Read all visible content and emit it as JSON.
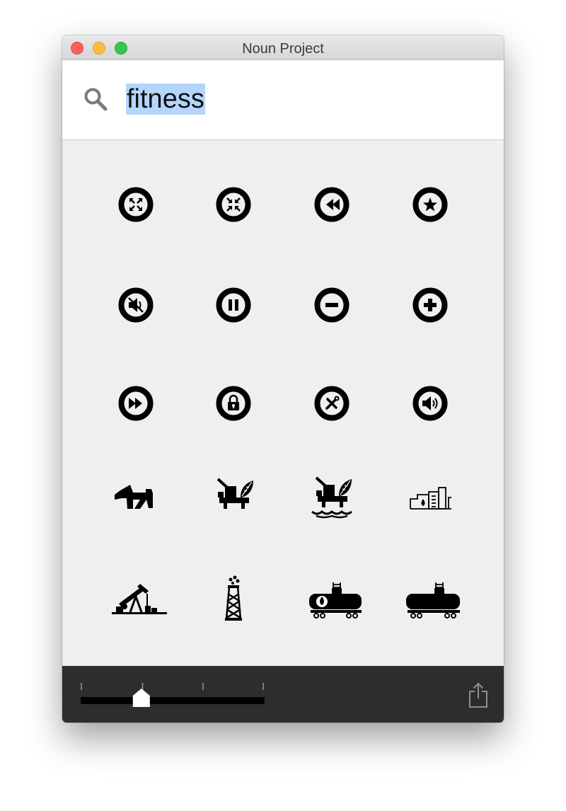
{
  "window": {
    "title": "Noun Project"
  },
  "search": {
    "query": "fitness"
  },
  "size_slider": {
    "value": 0.33,
    "ticks": 4
  },
  "icons": [
    {
      "name": "expand-circle-icon"
    },
    {
      "name": "collapse-circle-icon"
    },
    {
      "name": "rewind-circle-icon"
    },
    {
      "name": "star-circle-icon"
    },
    {
      "name": "mute-circle-icon"
    },
    {
      "name": "pause-circle-icon"
    },
    {
      "name": "minus-circle-icon"
    },
    {
      "name": "plus-circle-icon"
    },
    {
      "name": "fast-forward-circle-icon"
    },
    {
      "name": "lock-circle-icon"
    },
    {
      "name": "tools-circle-icon"
    },
    {
      "name": "volume-circle-icon"
    },
    {
      "name": "dog-icon"
    },
    {
      "name": "oil-rig-icon"
    },
    {
      "name": "offshore-oil-rig-icon"
    },
    {
      "name": "oil-refinery-icon"
    },
    {
      "name": "pumpjack-icon"
    },
    {
      "name": "oil-derrick-icon"
    },
    {
      "name": "fuel-tank-car-icon"
    },
    {
      "name": "tank-car-icon"
    }
  ]
}
